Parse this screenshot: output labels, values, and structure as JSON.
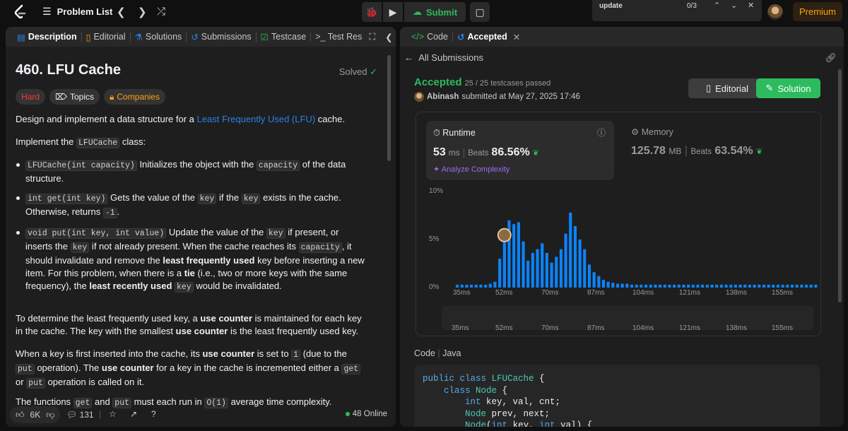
{
  "topbar": {
    "problem_list": "Problem List",
    "submit": "Submit",
    "find_query": "update",
    "find_count": "0/3",
    "premium": "Premium"
  },
  "left_tabs": [
    "Description",
    "Editorial",
    "Solutions",
    "Submissions",
    "Testcase",
    ">_ Test Res"
  ],
  "problem": {
    "title": "460. LFU Cache",
    "status": "Solved",
    "difficulty": "Hard",
    "topics": "Topics",
    "companies": "Companies",
    "intro_pre": "Design and implement a data structure for a ",
    "intro_link": "Least Frequently Used (LFU)",
    "intro_post": " cache.",
    "implement_pre": "Implement the ",
    "implement_code": "LFUCache",
    "implement_post": " class:",
    "bullets": [
      {
        "code": "LFUCache(int capacity)",
        "text_a": " Initializes the object with the ",
        "code2": "capacity",
        "text_b": " of the data structure."
      },
      {
        "code": "int get(int key)",
        "text_a": " Gets the value of the ",
        "code2": "key",
        "text_b": " if the ",
        "code3": "key",
        "text_c": " exists in the cache. Otherwise, returns ",
        "code4": "-1",
        "text_d": "."
      },
      {
        "code": "void put(int key, int value)",
        "text_a": " Update the value of the ",
        "code2": "key",
        "text_b": " if present, or inserts the ",
        "code3": "key",
        "text_c": " if not already present. When the cache reaches its ",
        "code4": "capacity",
        "text_d": ", it should invalidate and remove the ",
        "bold1": "least frequently used",
        "text_e": " key before inserting a new item. For this problem, when there is a ",
        "bold2": "tie",
        "text_f": " (i.e., two or more keys with the same frequency), the ",
        "bold3": "least recently used",
        "text_g": " ",
        "code5": "key",
        "text_h": " would be invalidated."
      }
    ],
    "para1_a": "To determine the least frequently used key, a ",
    "para1_b": "use counter",
    "para1_c": " is maintained for each key in the cache. The key with the smallest ",
    "para1_d": "use counter",
    "para1_e": " is the least frequently used key.",
    "para2_a": "When a key is first inserted into the cache, its ",
    "para2_b": "use counter",
    "para2_c": " is set to ",
    "para2_d": "1",
    "para2_e": " (due to the ",
    "para2_f": "put",
    "para2_g": " operation). The ",
    "para2_h": "use counter",
    "para2_i": " for a key in the cache is incremented either a ",
    "para2_j": "get",
    "para2_k": " or ",
    "para2_l": "put",
    "para2_m": " operation is called on it.",
    "para3_a": "The functions ",
    "para3_b": "get",
    "para3_c": " and ",
    "para3_d": "put",
    "para3_e": " must each run in ",
    "para3_f": "O(1)",
    "para3_g": " average time complexity."
  },
  "left_footer": {
    "likes": "6K",
    "comments": "131",
    "online": "48 Online"
  },
  "right_tabs": [
    "Code",
    "Accepted"
  ],
  "submission": {
    "back": "All Submissions",
    "status": "Accepted",
    "testcases": "25 / 25 testcases passed",
    "user": "Abinash",
    "submitted": "submitted at May 27, 2025 17:46",
    "editorial_btn": "Editorial",
    "solution_btn": "Solution",
    "runtime_label": "Runtime",
    "runtime_value": "53",
    "runtime_unit": "ms",
    "runtime_beats_label": "Beats",
    "runtime_beats": "86.56%",
    "analyze": "Analyze Complexity",
    "memory_label": "Memory",
    "memory_value": "125.78",
    "memory_unit": "MB",
    "memory_beats_label": "Beats",
    "memory_beats": "63.54%",
    "code_label": "Code",
    "language": "Java"
  },
  "chart_data": {
    "type": "bar",
    "ylabels": [
      "10%",
      "5%",
      "0%"
    ],
    "ylim": [
      0,
      10
    ],
    "xlabels": [
      "35ms",
      "52ms",
      "70ms",
      "87ms",
      "104ms",
      "121ms",
      "138ms",
      "155ms"
    ],
    "values": [
      0.3,
      0.3,
      0.3,
      0.3,
      0.3,
      0.3,
      0.3,
      0.4,
      0.6,
      3.0,
      5.6,
      7.0,
      6.6,
      6.8,
      4.8,
      2.8,
      3.6,
      4.0,
      4.6,
      3.6,
      2.6,
      3.2,
      4.0,
      5.6,
      7.8,
      6.4,
      5.0,
      4.0,
      2.4,
      1.6,
      1.2,
      0.8,
      0.6,
      0.5,
      0.4,
      0.4,
      0.4,
      0.3,
      0.3,
      0.3,
      0.3,
      0.3,
      0.3,
      0.3,
      0.3,
      0.3,
      0.3,
      0.3,
      0.3,
      0.3,
      0.3,
      0.3,
      0.3,
      0.3,
      0.3,
      0.3,
      0.3,
      0.3,
      0.3,
      0.3,
      0.3,
      0.3,
      0.3,
      0.3,
      0.3,
      0.3,
      0.3,
      0.3,
      0.3,
      0.3,
      0.3,
      0.3,
      0.3,
      0.3,
      0.3,
      0.3,
      0.3
    ],
    "highlight_index": 10,
    "color": "#0a84ff"
  },
  "code_lines": [
    [
      "kw:public class ",
      "ty:LFUCache",
      " {"
    ],
    [
      "    ",
      "kw:class ",
      "ty:Node",
      " {"
    ],
    [
      "        ",
      "kw:int",
      " key, val, cnt;"
    ],
    [
      "        ",
      "ty:Node",
      " prev, next;"
    ],
    [
      "        ",
      "ty:Node",
      "(",
      "kw:int",
      " key, ",
      "kw:int",
      " val) {"
    ]
  ]
}
